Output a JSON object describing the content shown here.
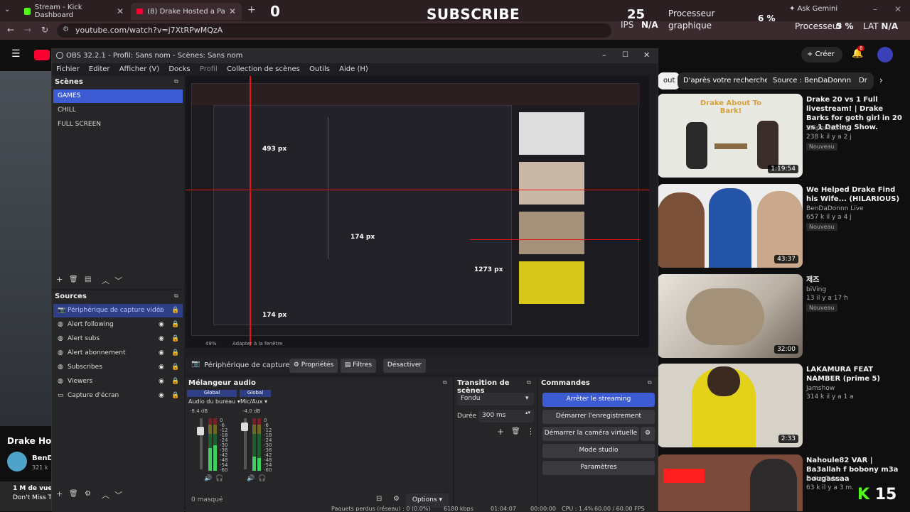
{
  "browser": {
    "tabs": [
      {
        "label": "Stream - Kick Dashboard"
      },
      {
        "label": "(8) Drake Hosted a Party! (FULL"
      }
    ],
    "url": "youtube.com/watch?v=j7XtRPwMQzA"
  },
  "overlay": {
    "left_count": "0",
    "subscribe": "SUBSCRIBE",
    "fps": "25",
    "ips_label": "IPS",
    "ips_value": "N/A",
    "gpu_label_line1": "Processeur",
    "gpu_label_line2": "graphique",
    "gpu_value": "6 %",
    "gemini": "Ask Gemini",
    "cpu_label": "Processeur",
    "cpu_value": "5 %",
    "lat_label": "LAT",
    "lat_value": "N/A"
  },
  "youtube": {
    "create_label": "Créer",
    "notif_count": "8",
    "chips": [
      "out",
      "D'après votre recherche",
      "Source : BenDaDonnn Live",
      "Dr"
    ],
    "videos": [
      {
        "title": "Drake 20 vs 1 Full livestream! | Drake Barks for goth girl in 20 vs 1 Dating Show.",
        "channel": "Sniper4strike",
        "meta": "238 k il y a 2 j",
        "badge": "Nouveau",
        "duration": "1:19:54",
        "thumb_text": "Drake About To Bark!"
      },
      {
        "title": "We Helped Drake Find his Wife... (HILARIOUS)",
        "channel": "BenDaDonnn Live",
        "meta": "657 k il y a 4 j",
        "badge": "Nouveau",
        "duration": "43:37"
      },
      {
        "title": "제즈",
        "channel": "biVing",
        "meta": "13 il y a 17 h",
        "badge": "Nouveau",
        "duration": "32:00"
      },
      {
        "title": "LAKAMURA FEAT NAMBER (prime 5)",
        "channel": "Jamshow",
        "meta": "314 k il y a 1 a",
        "badge": "",
        "duration": "2:33"
      },
      {
        "title": "Nahoule82 VAR | Ba3allah f bobony m3a bougassaa",
        "channel": "Delta Tube",
        "meta": "63 k il y a 3 m.",
        "badge": "",
        "duration": ""
      }
    ],
    "left_title": "Drake Hos",
    "left_channel": "BenD",
    "left_meta": "321 k",
    "left_desc1": "1 M de vues",
    "left_desc2": "Don't Miss Th",
    "kick_count": "15"
  },
  "obs": {
    "title": "OBS 32.2.1 - Profil: Sans nom - Scènes: Sans nom",
    "menu": [
      "Fichier",
      "Editer",
      "Afficher (V)",
      "Docks",
      "Profil",
      "Collection de scènes",
      "Outils",
      "Aide (H)"
    ],
    "scenes_title": "Scènes",
    "scenes": [
      "GAMES",
      "CHILL",
      "FULL SCREEN"
    ],
    "sources_title": "Sources",
    "sources": [
      "Périphérique de capture vidéo",
      "Alert following",
      "Alert subs",
      "Alert abonnement",
      "Subscribes",
      "Viewers",
      "Capture d'écran"
    ],
    "preview": {
      "px_top": "493 px",
      "px_right": "1273 px",
      "px_bottom": "174 px",
      "px_mid": "174 px",
      "zoom": "49%",
      "fit": "Adapter à la fenêtre"
    },
    "source_bar": {
      "name": "Périphérique de capture vic",
      "props": "Propriétés",
      "filters": "Filtres",
      "deactivate": "Désactiver"
    },
    "mixer": {
      "title": "Mélangeur audio",
      "channels": [
        {
          "tag": "Global",
          "name": "Audio du bureau",
          "db": "-8.4 dB"
        },
        {
          "tag": "Global",
          "name": "Mic/Aux",
          "db": "-4.0 dB"
        }
      ],
      "scale": [
        "0",
        "-6",
        "-12",
        "-18",
        "-24",
        "-30",
        "-36",
        "-42",
        "-48",
        "-54",
        "-60"
      ],
      "masked": "0 masqué",
      "options": "Options"
    },
    "transition": {
      "title": "Transition de scènes",
      "type": "Fondu",
      "duration_label": "Durée",
      "duration_value": "300 ms"
    },
    "commands": {
      "title": "Commandes",
      "buttons": [
        "Arrêter le streaming",
        "Démarrer l'enregistrement",
        "Démarrer la caméra virtuelle",
        "Mode studio",
        "Paramètres"
      ]
    },
    "status": {
      "dropped": "Paquets perdus (réseau) : 0 (0.0%)",
      "bitrate": "6180 kbps",
      "live_time": "01:04:07",
      "rec_time": "00:00:00",
      "cpu": "CPU : 1.4%",
      "fps": "60.00 / 60.00 FPS"
    }
  }
}
